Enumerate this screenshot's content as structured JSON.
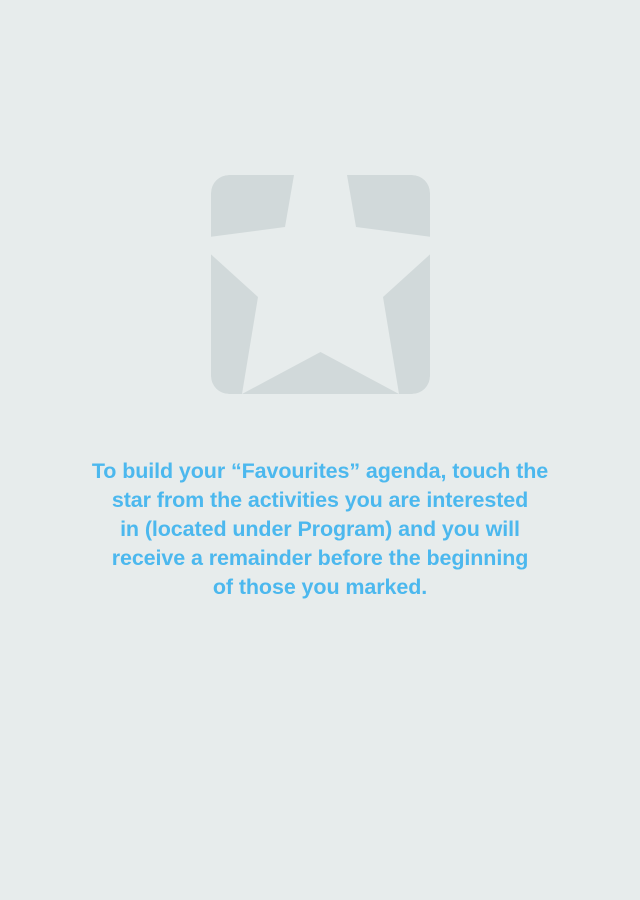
{
  "favourites_empty": {
    "icon": "star-icon",
    "icon_color": "#d1d9da",
    "background_color": "#e7ecec",
    "text_color": "#4cb8ee",
    "message_lines": [
      "To build your “Favourites” agenda, touch the",
      "star from the activities you are interested",
      "in (located under Program) and you will",
      "receive a remainder before the beginning",
      "of those you marked."
    ]
  }
}
